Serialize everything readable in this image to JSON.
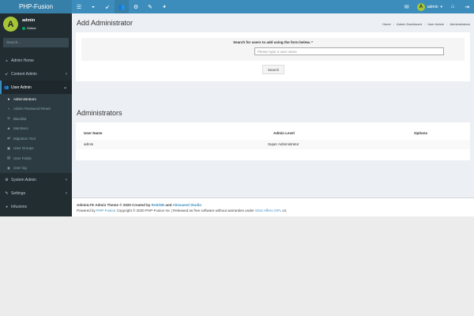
{
  "app": {
    "logo": "PHP-Fusion"
  },
  "topnav": {
    "icons": [
      "menu-icon",
      "dashboard-icon",
      "rocket-icon",
      "users-icon",
      "gear-icon",
      "wrench-icon",
      "palette-icon"
    ],
    "user_label": "admin",
    "avatar_letter": "A"
  },
  "sidebar": {
    "avatar_letter": "A",
    "username": "admin",
    "status": "Online",
    "search_placeholder": "Search...",
    "menu": {
      "admin_home": "Admin Home",
      "content_admin": "Content Admin",
      "user_admin": "User Admin",
      "system_admin": "System Admin",
      "settings": "Settings",
      "infusions": "Infusions"
    },
    "user_admin_items": [
      "Administrators",
      "Admin Password Reset",
      "Blacklist",
      "Members",
      "Migration Tool",
      "User Groups",
      "User Fields",
      "User log"
    ]
  },
  "page": {
    "title": "Add Administrator",
    "breadcrumb": [
      "Home",
      "Admin Dashboard",
      "User Admin",
      "Administrators"
    ],
    "search_label": "Search for users to add using the form below. *",
    "user_placeholder": "Please type a user name",
    "search_button": "Search"
  },
  "admins": {
    "title": "Administrators",
    "columns": [
      "User Name",
      "Admin Level",
      "Options"
    ],
    "rows": [
      {
        "user": "admin",
        "level": "Super Administrator",
        "options": ""
      }
    ]
  },
  "footer": {
    "theme_prefix": "AdminLTE Admin Theme © 2020 Created by",
    "author1": "RobiNN",
    "and": "and",
    "author2": "Almsaeed Studio",
    "powered_prefix": "Powered by",
    "powered_link": "PHP-Fusion",
    "copyright": "Copyright © 2020 PHP-Fusion Inc | Released as free software without warranties under",
    "license": "GNU Affero GPL",
    "version": "v3."
  },
  "colors": {
    "header": "#3c8dbc",
    "logo_bg": "#367fa9",
    "sidebar": "#222d32",
    "avatar": "#a6c638",
    "online": "#00a65a",
    "content_bg": "#ecf0f5"
  }
}
